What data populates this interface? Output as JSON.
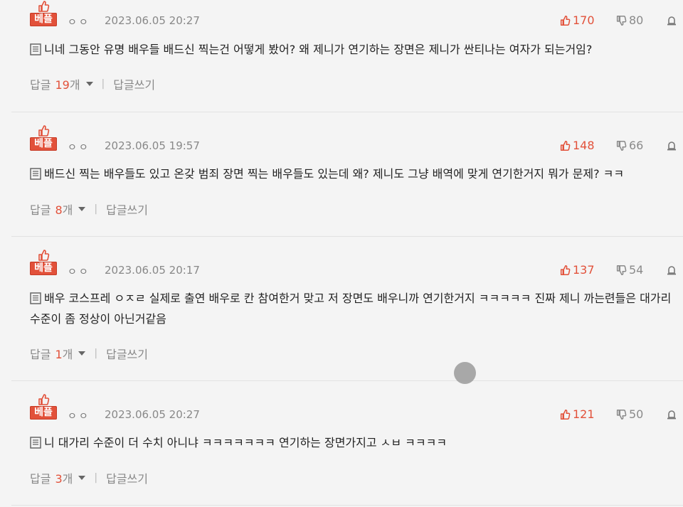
{
  "comments": [
    {
      "badge": "베플",
      "author": "ㅇㅇ",
      "date": "2023.06.05 20:27",
      "up": "170",
      "down": "80",
      "text": "니네 그동안 유명 배우들 배드신 찍는건 어떻게 봤어? 왜 제니가 연기하는 장면은 제니가 싼티나는 여자가 되는거임?",
      "reply_label": "답글",
      "reply_count": "19",
      "reply_unit": "개",
      "write_label": "답글쓰기"
    },
    {
      "badge": "베플",
      "author": "ㅇㅇ",
      "date": "2023.06.05 19:57",
      "up": "148",
      "down": "66",
      "text": "배드신 찍는 배우들도 있고 온갖 범죄 장면 찍는 배우들도 있는데 왜? 제니도 그냥 배역에 맞게 연기한거지 뭐가 문제? ㅋㅋ",
      "reply_label": "답글",
      "reply_count": "8",
      "reply_unit": "개",
      "write_label": "답글쓰기"
    },
    {
      "badge": "베플",
      "author": "ㅇㅇ",
      "date": "2023.06.05 20:17",
      "up": "137",
      "down": "54",
      "text": "배우 코스프레 ㅇㅈㄹ 실제로 출연 배우로 칸 참여한거 맞고 저 장면도 배우니까 연기한거지 ㅋㅋㅋㅋㅋ 진짜 제니 까는련들은 대가리 수준이 좀 정상이 아닌거같음",
      "reply_label": "답글",
      "reply_count": "1",
      "reply_unit": "개",
      "write_label": "답글쓰기"
    },
    {
      "badge": "베플",
      "author": "ㅇㅇ",
      "date": "2023.06.05 20:27",
      "up": "121",
      "down": "50",
      "text": "니 대가리 수준이 더 수치 아니냐 ㅋㅋㅋㅋㅋㅋㅋ 연기하는 장면가지고 ㅅㅂ ㅋㅋㅋㅋ",
      "reply_label": "답글",
      "reply_count": "3",
      "reply_unit": "개",
      "write_label": "답글쓰기"
    }
  ],
  "colors": {
    "accent": "#e2513a",
    "muted": "#888888",
    "background": "#f4f4f4"
  }
}
